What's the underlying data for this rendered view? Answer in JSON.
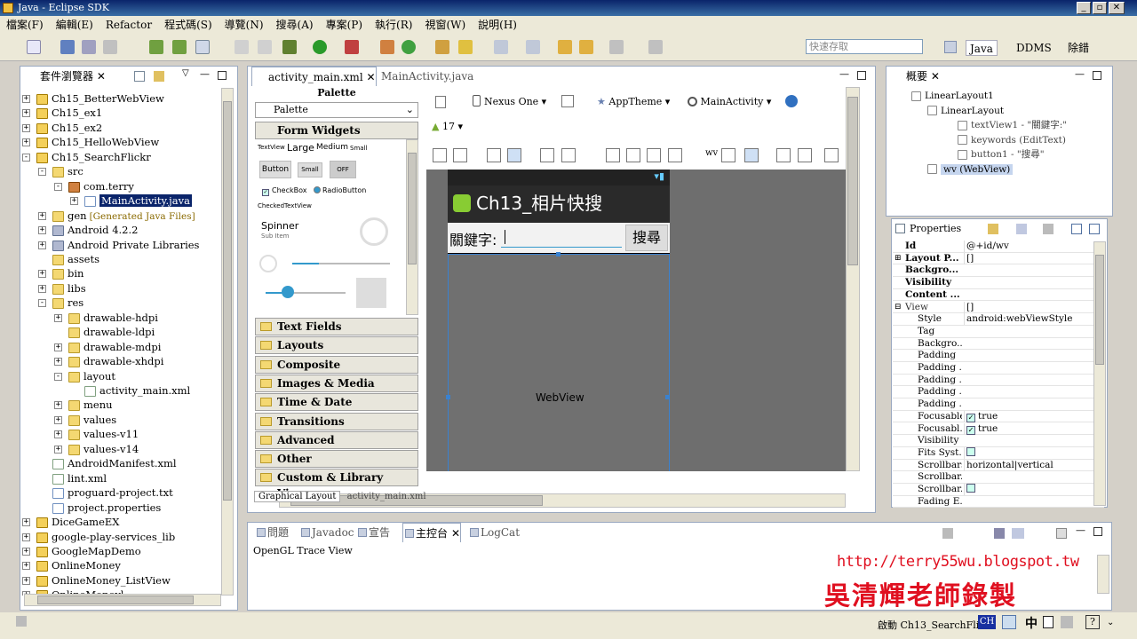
{
  "window": {
    "title": "Java - Eclipse SDK"
  },
  "menu": [
    "檔案(F)",
    "編輯(E)",
    "Refactor",
    "程式碼(S)",
    "導覽(N)",
    "搜尋(A)",
    "專案(P)",
    "執行(R)",
    "視窗(W)",
    "說明(H)"
  ],
  "toolbar": {
    "quick_access_placeholder": "快速存取",
    "perspectives": [
      "Java",
      "DDMS",
      "除錯"
    ]
  },
  "package_explorer": {
    "tab_label": "套件瀏覽器",
    "rows": [
      {
        "label": "Ch15_BetterWebView",
        "depth": 0,
        "icon": "project",
        "exp": "+"
      },
      {
        "label": "Ch15_ex1",
        "depth": 0,
        "icon": "project",
        "exp": "+"
      },
      {
        "label": "Ch15_ex2",
        "depth": 0,
        "icon": "project",
        "exp": "+"
      },
      {
        "label": "Ch15_HelloWebView",
        "depth": 0,
        "icon": "project",
        "exp": "+"
      },
      {
        "label": "Ch15_SearchFlickr",
        "depth": 0,
        "icon": "project",
        "exp": "-"
      },
      {
        "label": "src",
        "depth": 1,
        "icon": "folder",
        "exp": "-"
      },
      {
        "label": "com.terry",
        "depth": 2,
        "icon": "package",
        "exp": "-"
      },
      {
        "label": "MainActivity.java",
        "depth": 3,
        "icon": "java",
        "exp": "+",
        "selected": true
      },
      {
        "label": "gen",
        "depth": 1,
        "icon": "folder",
        "exp": "+",
        "note": "[Generated Java Files]"
      },
      {
        "label": "Android 4.2.2",
        "depth": 1,
        "icon": "lib",
        "exp": "+"
      },
      {
        "label": "Android Private Libraries",
        "depth": 1,
        "icon": "lib",
        "exp": "+"
      },
      {
        "label": "assets",
        "depth": 1,
        "icon": "folder",
        "exp": ""
      },
      {
        "label": "bin",
        "depth": 1,
        "icon": "folder",
        "exp": "+"
      },
      {
        "label": "libs",
        "depth": 1,
        "icon": "folder",
        "exp": "+"
      },
      {
        "label": "res",
        "depth": 1,
        "icon": "folder",
        "exp": "-"
      },
      {
        "label": "drawable-hdpi",
        "depth": 2,
        "icon": "folder",
        "exp": "+"
      },
      {
        "label": "drawable-ldpi",
        "depth": 2,
        "icon": "folder",
        "exp": ""
      },
      {
        "label": "drawable-mdpi",
        "depth": 2,
        "icon": "folder",
        "exp": "+"
      },
      {
        "label": "drawable-xhdpi",
        "depth": 2,
        "icon": "folder",
        "exp": "+"
      },
      {
        "label": "layout",
        "depth": 2,
        "icon": "folder",
        "exp": "-"
      },
      {
        "label": "activity_main.xml",
        "depth": 3,
        "icon": "xml",
        "exp": ""
      },
      {
        "label": "menu",
        "depth": 2,
        "icon": "folder",
        "exp": "+"
      },
      {
        "label": "values",
        "depth": 2,
        "icon": "folder",
        "exp": "+"
      },
      {
        "label": "values-v11",
        "depth": 2,
        "icon": "folder",
        "exp": "+"
      },
      {
        "label": "values-v14",
        "depth": 2,
        "icon": "folder",
        "exp": "+"
      },
      {
        "label": "AndroidManifest.xml",
        "depth": 1,
        "icon": "xml",
        "exp": ""
      },
      {
        "label": "lint.xml",
        "depth": 1,
        "icon": "xml",
        "exp": ""
      },
      {
        "label": "proguard-project.txt",
        "depth": 1,
        "icon": "file",
        "exp": ""
      },
      {
        "label": "project.properties",
        "depth": 1,
        "icon": "file",
        "exp": ""
      },
      {
        "label": "DiceGameEX",
        "depth": 0,
        "icon": "project",
        "exp": "+"
      },
      {
        "label": "google-play-services_lib",
        "depth": 0,
        "icon": "project",
        "exp": "+"
      },
      {
        "label": "GoogleMapDemo",
        "depth": 0,
        "icon": "project",
        "exp": "+"
      },
      {
        "label": "OnlineMoney",
        "depth": 0,
        "icon": "project",
        "exp": "+"
      },
      {
        "label": "OnlineMoney_ListView",
        "depth": 0,
        "icon": "project",
        "exp": "+"
      },
      {
        "label": "OnlineMoneyl",
        "depth": 0,
        "icon": "project",
        "exp": "+"
      }
    ]
  },
  "editor": {
    "tabs": [
      "activity_main.xml",
      "MainActivity.java"
    ],
    "palette_title": "Palette",
    "palette_dropdown": "Palette",
    "form_widgets": "Form Widgets",
    "widgets": {
      "textview": "TextView",
      "large": "Large",
      "medium": "Medium",
      "small": "Small",
      "button": "Button",
      "small_btn": "Small",
      "off": "OFF",
      "checkbox": "CheckBox",
      "radio": "RadioButton",
      "checked_tv": "CheckedTextView",
      "spinner": "Spinner",
      "sub_item": "Sub Item"
    },
    "categories": [
      "Text Fields",
      "Layouts",
      "Composite",
      "Images & Media",
      "Time & Date",
      "Transitions",
      "Advanced",
      "Other",
      "Custom & Library Views"
    ],
    "device": "Nexus One",
    "theme": "AppTheme",
    "activity": "MainActivity",
    "api": "17",
    "layout_toolbar_label": "wv",
    "bottom_tabs": [
      "Graphical Layout",
      "activity_main.xml"
    ],
    "phone": {
      "app_title": "Ch13_相片快搜",
      "label": "關鍵字:",
      "button": "搜尋",
      "webview": "WebView"
    }
  },
  "outline": {
    "tab_label": "概要",
    "nodes": [
      "LinearLayout1",
      "LinearLayout",
      "textView1 - \"關鍵字:\"",
      "keywords (EditText)",
      "button1 - \"搜尋\"",
      "wv (WebView)"
    ]
  },
  "properties": {
    "title": "Properties",
    "rows": [
      {
        "name": "Id",
        "value": "@+id/wv",
        "bold": true,
        "exp": ""
      },
      {
        "name": "Layout P...",
        "value": "[]",
        "bold": true,
        "exp": "+"
      },
      {
        "name": "Backgro...",
        "value": "",
        "bold": true,
        "exp": ""
      },
      {
        "name": "Visibility",
        "value": "",
        "bold": true,
        "exp": ""
      },
      {
        "name": "Content ...",
        "value": "",
        "bold": true,
        "exp": ""
      },
      {
        "name": "View",
        "value": "[]",
        "bold": false,
        "exp": "-",
        "indent": 0
      },
      {
        "name": "Style",
        "value": "android:webViewStyle",
        "bold": false,
        "exp": ""
      },
      {
        "name": "Tag",
        "value": "",
        "exp": ""
      },
      {
        "name": "Backgro...",
        "value": "",
        "exp": ""
      },
      {
        "name": "Padding",
        "value": "",
        "exp": ""
      },
      {
        "name": "Padding ...",
        "value": "",
        "exp": ""
      },
      {
        "name": "Padding ...",
        "value": "",
        "exp": ""
      },
      {
        "name": "Padding ...",
        "value": "",
        "exp": ""
      },
      {
        "name": "Padding ...",
        "value": "",
        "exp": ""
      },
      {
        "name": "Focusable",
        "value": "true",
        "check": true,
        "exp": ""
      },
      {
        "name": "Focusabl...",
        "value": "true",
        "check": true,
        "exp": ""
      },
      {
        "name": "Visibility",
        "value": "",
        "exp": ""
      },
      {
        "name": "Fits Syst...",
        "value": "",
        "check": false,
        "box": true,
        "exp": ""
      },
      {
        "name": "Scrollbars",
        "value": "horizontal|vertical",
        "exp": ""
      },
      {
        "name": "Scrollbar...",
        "value": "",
        "exp": ""
      },
      {
        "name": "Scrollbar...",
        "value": "",
        "box": true,
        "exp": ""
      },
      {
        "name": "Fading E...",
        "value": "",
        "exp": ""
      }
    ]
  },
  "console": {
    "tabs": [
      "問題",
      "Javadoc",
      "宣告",
      "主控台",
      "LogCat"
    ],
    "content": "OpenGL Trace View"
  },
  "watermark": {
    "url": "http://terry55wu.blogspot.tw",
    "author": "吳清輝老師錄製"
  },
  "taskbar": {
    "task": "啟動 Ch13_SearchFlickr",
    "ime": "CH",
    "ime2": "中"
  }
}
